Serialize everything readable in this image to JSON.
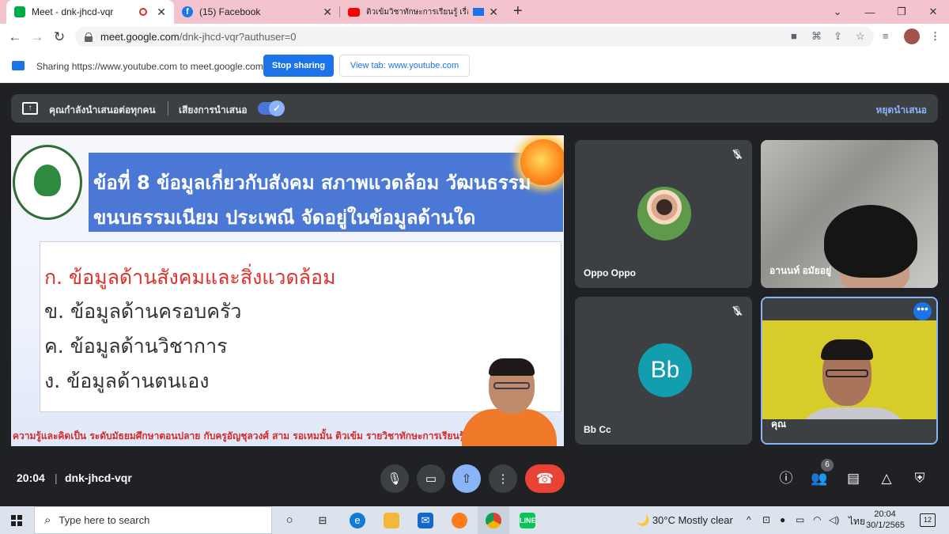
{
  "browser": {
    "tabs": [
      {
        "title": "Meet - dnk-jhcd-vqr",
        "active": true
      },
      {
        "title": "(15) Facebook",
        "active": false
      },
      {
        "title": "ติวเข้มวิชาทักษะการเรียนรู้ เรื่อง ก",
        "active": false
      }
    ],
    "new_tab_label": "+",
    "url_host": "meet.google.com",
    "url_path": "/dnk-jhcd-vqr?authuser=0",
    "accent_color": "#f3c4ce"
  },
  "sharing_bar": {
    "text": "Sharing https://www.youtube.com to meet.google.com",
    "stop_label": "Stop sharing",
    "view_label": "View tab: www.youtube.com"
  },
  "present_banner": {
    "status": "คุณกำลังนำเสนอต่อทุกคน",
    "audio_label": "เสียงการนำเสนอ",
    "audio_on": true,
    "stop_label": "หยุดนำเสนอ"
  },
  "slide": {
    "question_line1": "ข้อที่ 8 ข้อมูลเกี่ยวกับสังคม สภาพแวดล้อม วัฒนธรรม",
    "question_line2": "ขนบธรรมเนียม ประเพณี จัดอยู่ในข้อมูลด้านใด",
    "choices": [
      "ก. ข้อมูลด้านสังคมและสิ่งแวดล้อม",
      "ข. ข้อมูลด้านครอบครัว",
      "ค. ข้อมูลด้านวิชาการ",
      "ง. ข้อมูลด้านตนเอง"
    ],
    "footer": "ความรู้และคิดเป็น ระดับมัธยมศึกษาตอนปลาย กับครูอัญชุลวงศ์ สาม รอเหมมั้น ติวเข้ม รายวิชาทักษะการเรียนรู้ เรื่อง ก"
  },
  "participants": [
    {
      "name": "Oppo Oppo",
      "muted": true
    },
    {
      "name": "อานนท์ อมัยอยู่",
      "muted": false
    },
    {
      "name": "Bb Cc",
      "initials": "Bb",
      "muted": true
    },
    {
      "name": "คุณ",
      "muted": false
    }
  ],
  "meeting": {
    "time": "20:04",
    "code": "dnk-jhcd-vqr",
    "people_count": "6"
  },
  "taskbar": {
    "search_placeholder": "Type here to search",
    "weather": "30°C  Mostly clear",
    "language": "ไทย",
    "clock_time": "20:04",
    "clock_date": "30/1/2565",
    "notifications": "12"
  }
}
